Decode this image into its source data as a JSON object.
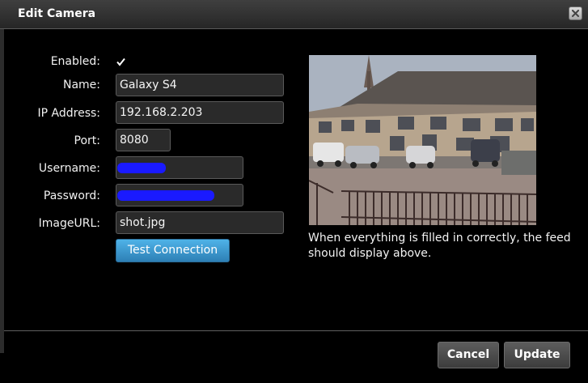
{
  "dialog": {
    "title": "Edit Camera",
    "close_icon": "close-icon"
  },
  "form": {
    "enabled": {
      "label": "Enabled:",
      "checked": true
    },
    "name": {
      "label": "Name:",
      "value": "Galaxy S4"
    },
    "ip": {
      "label": "IP Address:",
      "value": "192.168.2.203"
    },
    "port": {
      "label": "Port:",
      "value": "8080"
    },
    "username": {
      "label": "Username:",
      "value": ""
    },
    "password": {
      "label": "Password:",
      "value": ""
    },
    "image_url": {
      "label": "ImageURL:",
      "value": "shot.jpg"
    },
    "test_button": "Test Connection"
  },
  "preview": {
    "caption": "When everything is filled in correctly, the feed should display above."
  },
  "footer": {
    "cancel": "Cancel",
    "update": "Update"
  },
  "colors": {
    "accent_button": "#3a95cf",
    "redaction": "#1a1aff"
  }
}
